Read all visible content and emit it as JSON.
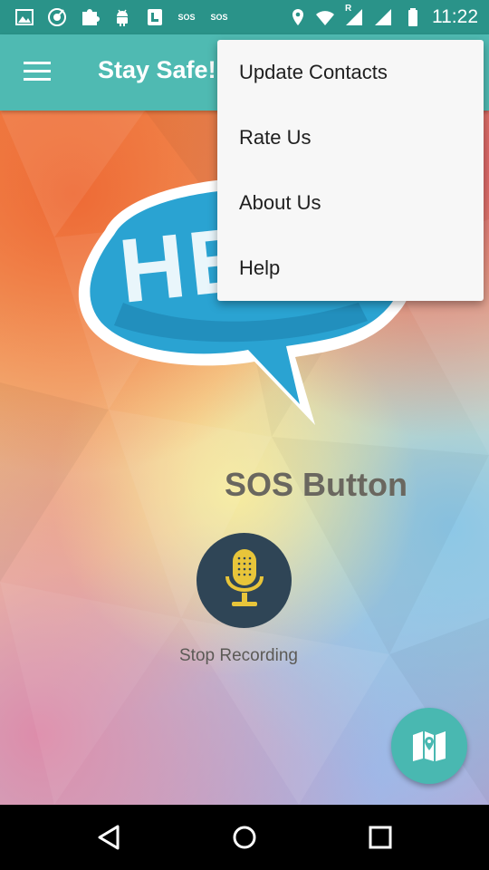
{
  "status_bar": {
    "time": "11:22",
    "left_icons": [
      "gallery-icon",
      "music-icon",
      "puzzle-icon",
      "android-icon",
      "card-icon",
      "sos-icon",
      "sos-icon"
    ],
    "sos_label": "SOS",
    "right_icons": [
      "location-icon",
      "wifi-icon",
      "signal-roaming-icon",
      "signal-icon",
      "battery-icon"
    ],
    "roaming_label": "R"
  },
  "app_bar": {
    "title": "Stay Safe!",
    "menu_icon": "hamburger-menu-icon"
  },
  "overflow_menu": {
    "items": [
      {
        "label": "Update Contacts"
      },
      {
        "label": "Rate Us"
      },
      {
        "label": "About Us"
      },
      {
        "label": "Help"
      }
    ]
  },
  "main": {
    "help_image_text": "HELP",
    "sos_title": "SOS Button",
    "mic_icon": "microphone-icon",
    "record_label": "Stop Recording",
    "map_button_icon": "map-icon"
  },
  "nav_bar": {
    "buttons": [
      "back-icon",
      "home-icon",
      "recents-icon"
    ]
  },
  "colors": {
    "status_bar": "#2a9389",
    "app_bar": "#4fbab2",
    "mic_button": "#2f4556",
    "mic_icon": "#e8c53a",
    "fab": "#49b8b1",
    "sos_title": "#6a675f",
    "help_bubble": "#2aa3d2"
  }
}
